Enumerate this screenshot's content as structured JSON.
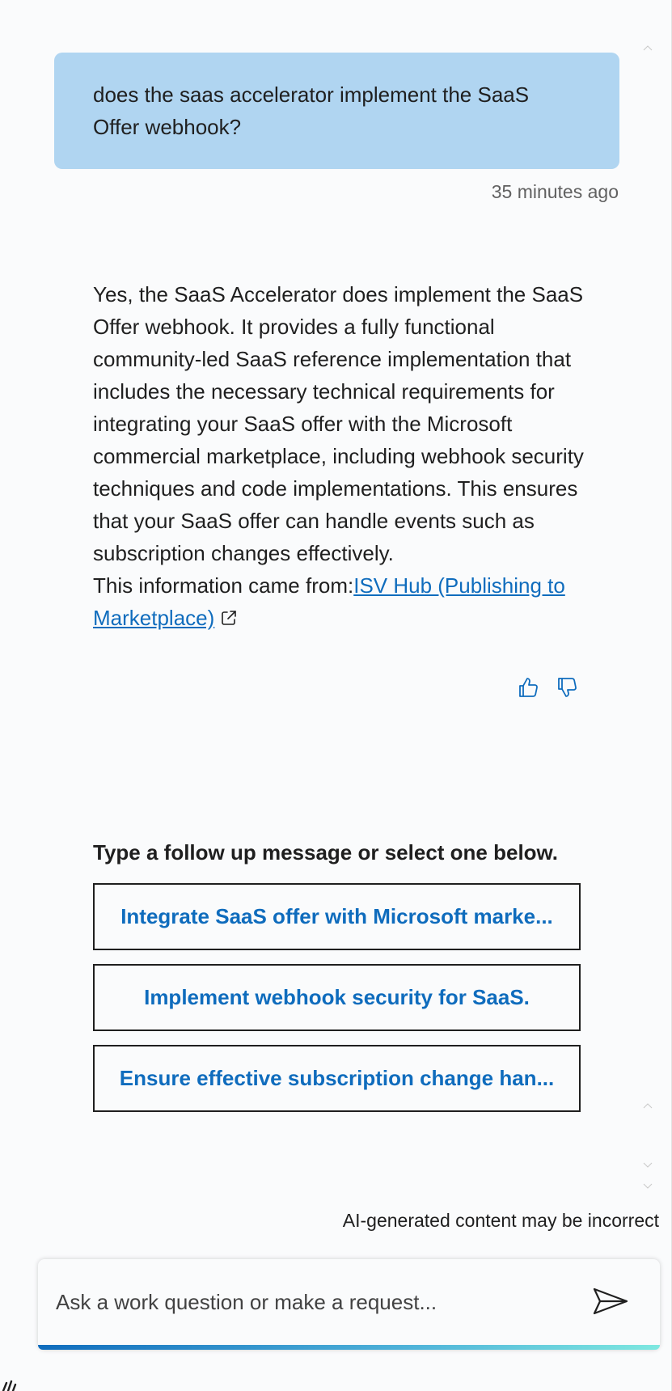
{
  "conversation": {
    "user_message": "does the saas accelerator implement the SaaS Offer webhook?",
    "timestamp": "35 minutes ago",
    "answer_text": "Yes, the SaaS Accelerator does implement the SaaS Offer webhook. It provides a fully functional community-led SaaS reference implementation that includes the necessary technical requirements for integrating your SaaS offer with the Microsoft commercial marketplace, including webhook security techniques and code implementations. This ensures that your SaaS offer can handle events such as subscription changes effectively.",
    "source_prefix": "This information came from:",
    "source_link_text": "ISV Hub (Publishing to Marketplace)"
  },
  "feedback": {
    "thumbs_up_icon": "thumbs-up-icon",
    "thumbs_down_icon": "thumbs-down-icon"
  },
  "followup": {
    "heading": "Type a follow up message or select one below.",
    "suggestions": [
      "Integrate SaaS offer with Microsoft marke...",
      "Implement webhook security for SaaS.",
      "Ensure effective subscription change han..."
    ]
  },
  "footer": {
    "disclaimer": "AI-generated content may be incorrect"
  },
  "composer": {
    "placeholder": "Ask a work question or make a request..."
  },
  "colors": {
    "user_bubble": "#b0d5f1",
    "link": "#0f6cbd",
    "page_background": "#fafbfc"
  }
}
